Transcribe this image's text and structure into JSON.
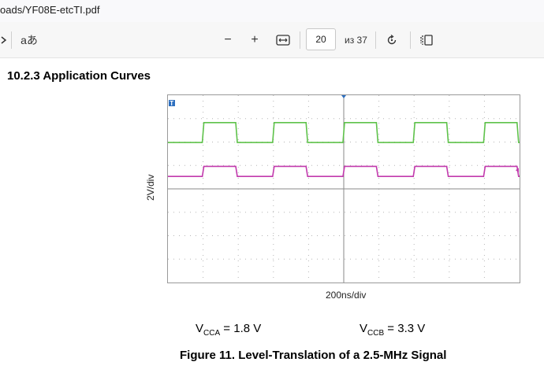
{
  "window": {
    "title": "oads/YF08E-etcTI.pdf"
  },
  "toolbar": {
    "aa_label": "aあ",
    "zoom_out": "−",
    "zoom_in": "+",
    "page_value": "20",
    "page_count": "из 37"
  },
  "document": {
    "section_title": "10.2.3   Application Curves",
    "ylabel": "2V/div",
    "xlabel": "200ns/div",
    "vcca_prefix": "V",
    "vcca_sub": "CCA",
    "vcca_value": " = 1.8 V",
    "vccb_prefix": "V",
    "vccb_sub": "CCB",
    "vccb_value": " = 3.3 V",
    "caption": "Figure 11.  Level-Translation of a 2.5-MHz Signal",
    "trigger_marker": "T"
  },
  "colors": {
    "green_trace": "#5ec24a",
    "magenta_trace": "#c23aad",
    "trigger": "#2d6fbf"
  },
  "chart_data": {
    "type": "line",
    "xlabel": "200ns/div",
    "ylabel": "2V/div",
    "x_divisions": 10,
    "y_divisions": 8,
    "frequency": "2.5-MHz",
    "series": [
      {
        "name": "V_CCA = 1.8 V",
        "levels": [
          "low",
          "high"
        ],
        "edges_div": [
          1.0,
          1.95,
          3.0,
          3.95,
          5.0,
          5.95,
          7.0,
          7.95,
          9.0,
          9.95
        ]
      },
      {
        "name": "V_CCB = 3.3 V",
        "levels": [
          "low",
          "high"
        ],
        "edges_div": [
          1.0,
          1.95,
          3.0,
          3.95,
          5.0,
          5.95,
          7.0,
          7.95,
          9.0,
          9.95
        ]
      }
    ]
  }
}
